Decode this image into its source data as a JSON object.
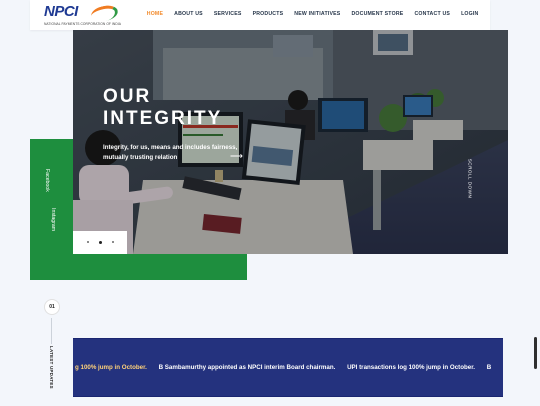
{
  "header": {
    "logo_text": "NPCI",
    "logo_subtext": "NATIONAL PAYMENTS CORPORATION OF INDIA",
    "nav": [
      "HOME",
      "ABOUT US",
      "SERVICES",
      "PRODUCTS",
      "NEW INITIATIVES",
      "DOCUMENT STORE",
      "CONTACT US",
      "LOGIN"
    ],
    "active_nav": "HOME",
    "accent_color": "#f28a2b"
  },
  "hero": {
    "title_line1": "OUR",
    "title_line2": "INTEGRITY",
    "text": "Integrity, for us, means and includes fairness, mutually trusting relation",
    "arrow_icon": "arrow-right-icon",
    "scroll_label": "SCROLL DOWN"
  },
  "social": {
    "facebook": "Facebook",
    "instagram": "Instagram",
    "block_color": "#1e8e3e"
  },
  "slider": {
    "slides_total": 3,
    "active_slide": 2
  },
  "updates": {
    "index": "01",
    "label": "LATEST UPDATES",
    "ticker": [
      "g 100% jump in October.",
      "B Sambamurthy appointed as NPCI interim Board chairman.",
      "UPI transactions log 100% jump in October.",
      "B"
    ],
    "ticker_bg": "#24327e"
  }
}
